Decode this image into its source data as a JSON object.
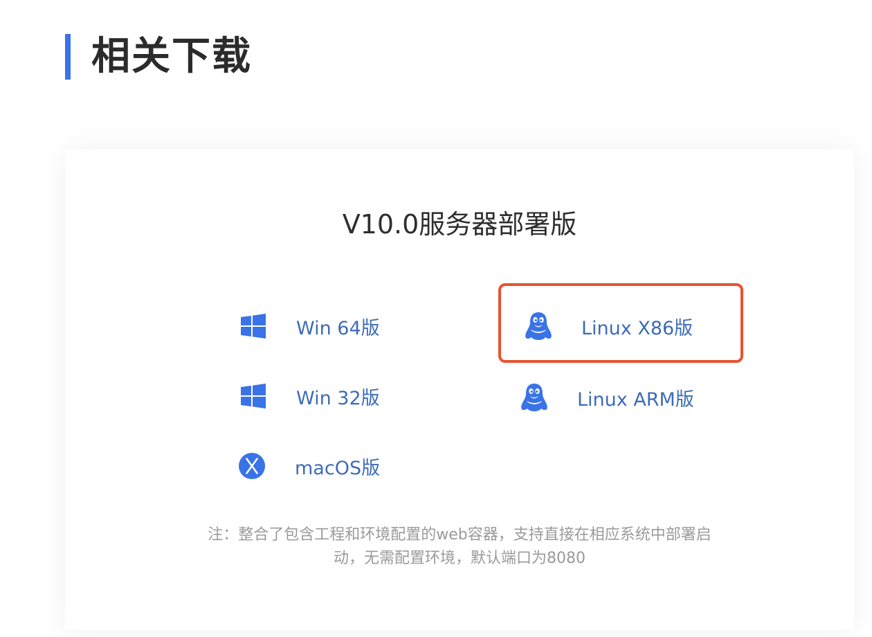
{
  "section": {
    "title": "相关下载"
  },
  "card": {
    "title": "V10.0服务器部署版",
    "downloads": [
      {
        "label": "Win 64版",
        "icon": "windows-icon"
      },
      {
        "label": "Linux X86版",
        "icon": "linux-penguin-icon",
        "highlighted": true
      },
      {
        "label": "Win 32版",
        "icon": "windows-icon"
      },
      {
        "label": "Linux ARM版",
        "icon": "linux-penguin-icon"
      },
      {
        "label": "macOS版",
        "icon": "macos-x-icon"
      }
    ],
    "note_line1": "注：整合了包含工程和环境配置的web容器，支持直接在相应系统中部署启",
    "note_line2": "动，无需配置环境，默认端口为8080"
  },
  "colors": {
    "accent_bar": "#3a73e8",
    "icon_blue": "#3a73e8",
    "link_text": "#3d6cb8",
    "highlight_border": "#e8522f"
  }
}
